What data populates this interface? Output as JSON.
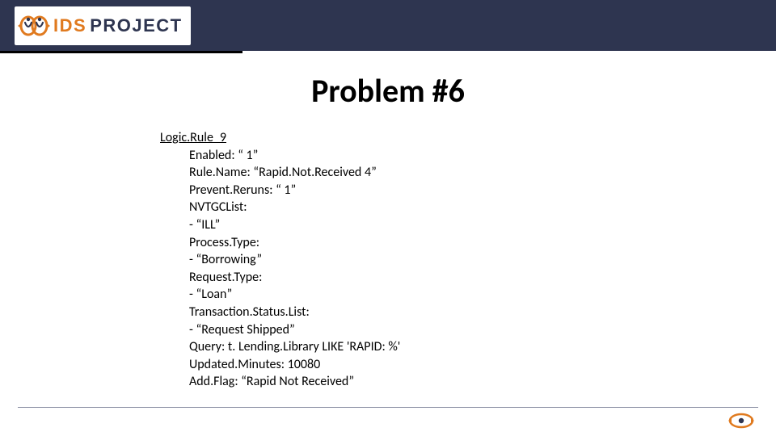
{
  "header": {
    "logo_ids": "IDS",
    "logo_project": "PROJECT"
  },
  "title": "Problem #6",
  "rule": {
    "header": "Logic.Rule_9",
    "props": [
      "Enabled: “ 1”",
      "Rule.Name: “Rapid.Not.Received 4”",
      "Prevent.Reruns: “ 1”",
      "NVTGCList:",
      "- “ILL”",
      "Process.Type:",
      "- “Borrowing”",
      "Request.Type:",
      "- “Loan”",
      "Transaction.Status.List:",
      "- “Request Shipped”",
      "Query: t. Lending.Library LIKE 'RAPID: %'",
      "Updated.Minutes: 10080",
      "Add.Flag: “Rapid Not Received”"
    ]
  }
}
